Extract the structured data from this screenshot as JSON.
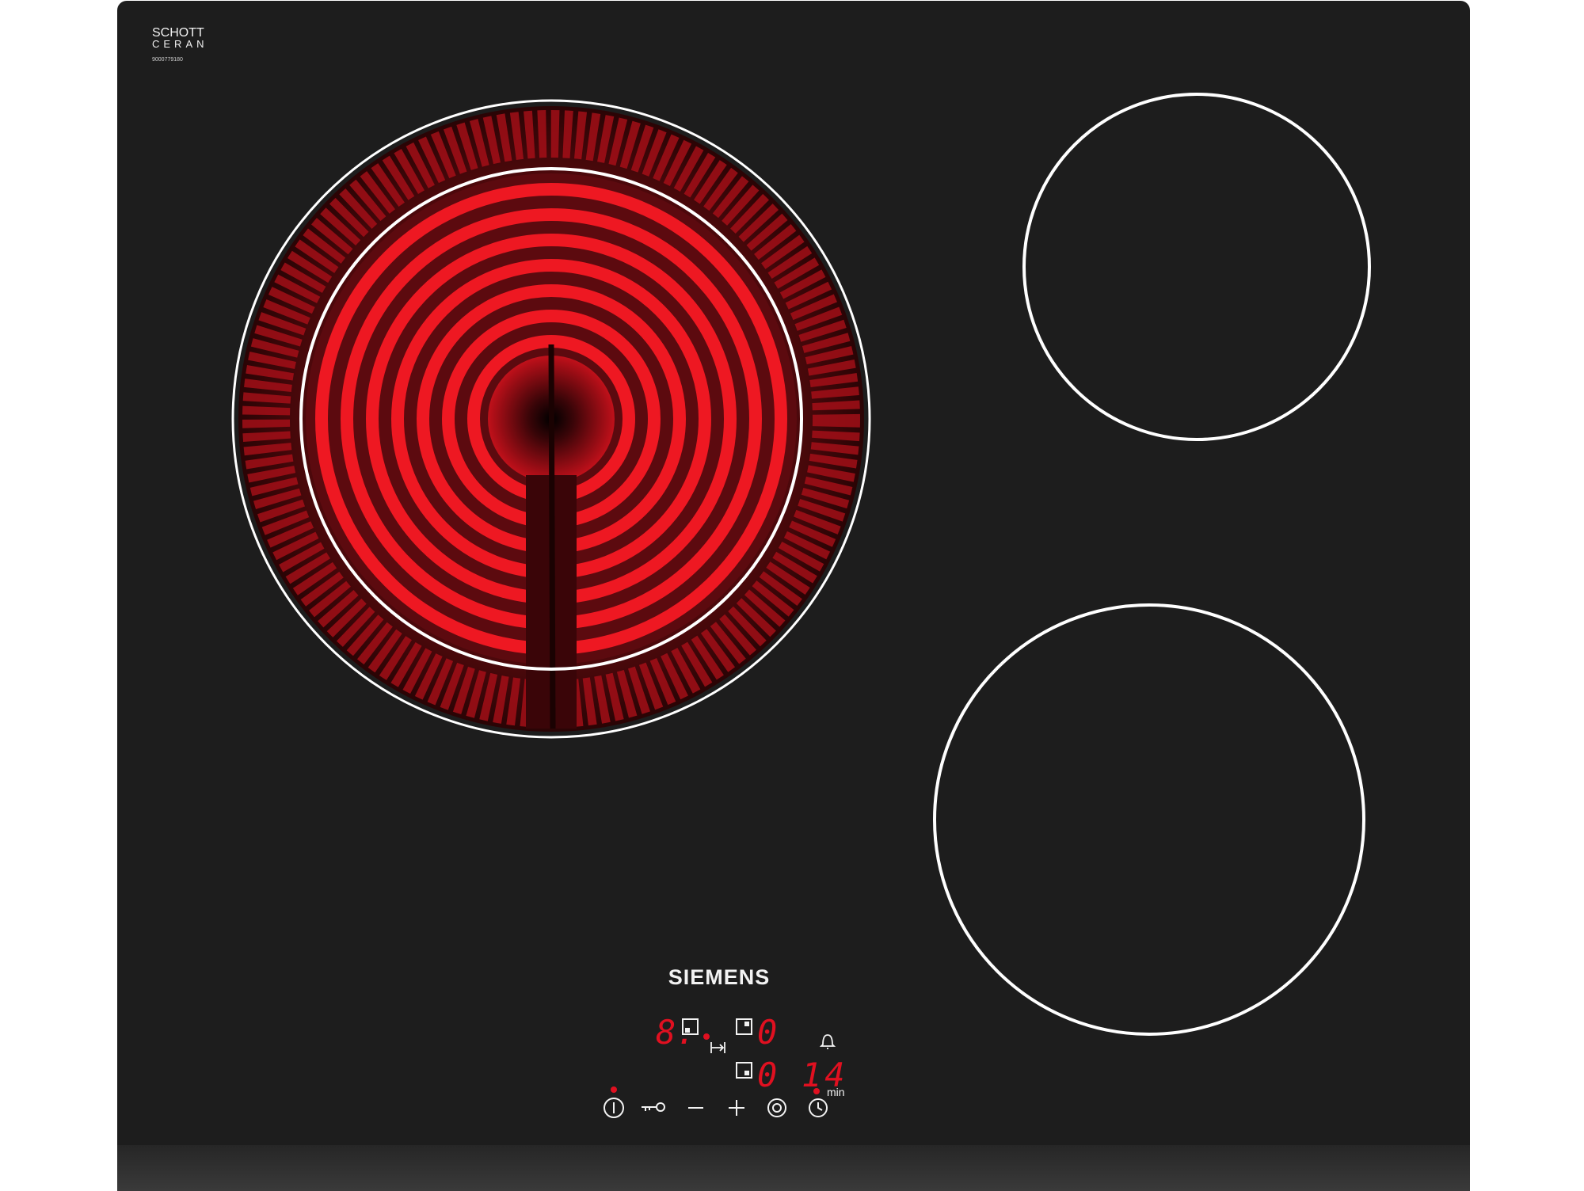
{
  "brand": {
    "glass_maker_line1": "SCHOTT",
    "glass_maker_line2": "CERAN",
    "product_code": "9000779180",
    "logo": "SIEMENS"
  },
  "displays": {
    "zone_front_left": "8.",
    "zone_rear_left": "0",
    "zone_rear_right": "0",
    "timer": "14",
    "timer_unit": "min"
  },
  "icons": {
    "zone_indicators": [
      "zone-front-left-icon",
      "zone-rear-icon",
      "zone-back-icon"
    ],
    "timer_to_zone": "arrow-to-bar-icon",
    "alarm": "bell-icon",
    "buttons": [
      "power-icon",
      "key-lock-icon",
      "minus-icon",
      "plus-icon",
      "select-zone-icon",
      "timer-clock-icon"
    ]
  },
  "colors": {
    "glass": "#1d1d1d",
    "glass_bottom_edge": "#2b2b2b",
    "zone_ring": "#ffffff",
    "heater_red": "#e8141e",
    "heater_dark": "#3a0508",
    "led_red": "#e01020",
    "print": "#f2f2f2"
  },
  "zones": {
    "front_left": {
      "state": "on",
      "type": "dual-ring"
    },
    "rear_right": {
      "state": "off"
    },
    "front_right": {
      "state": "off"
    }
  }
}
